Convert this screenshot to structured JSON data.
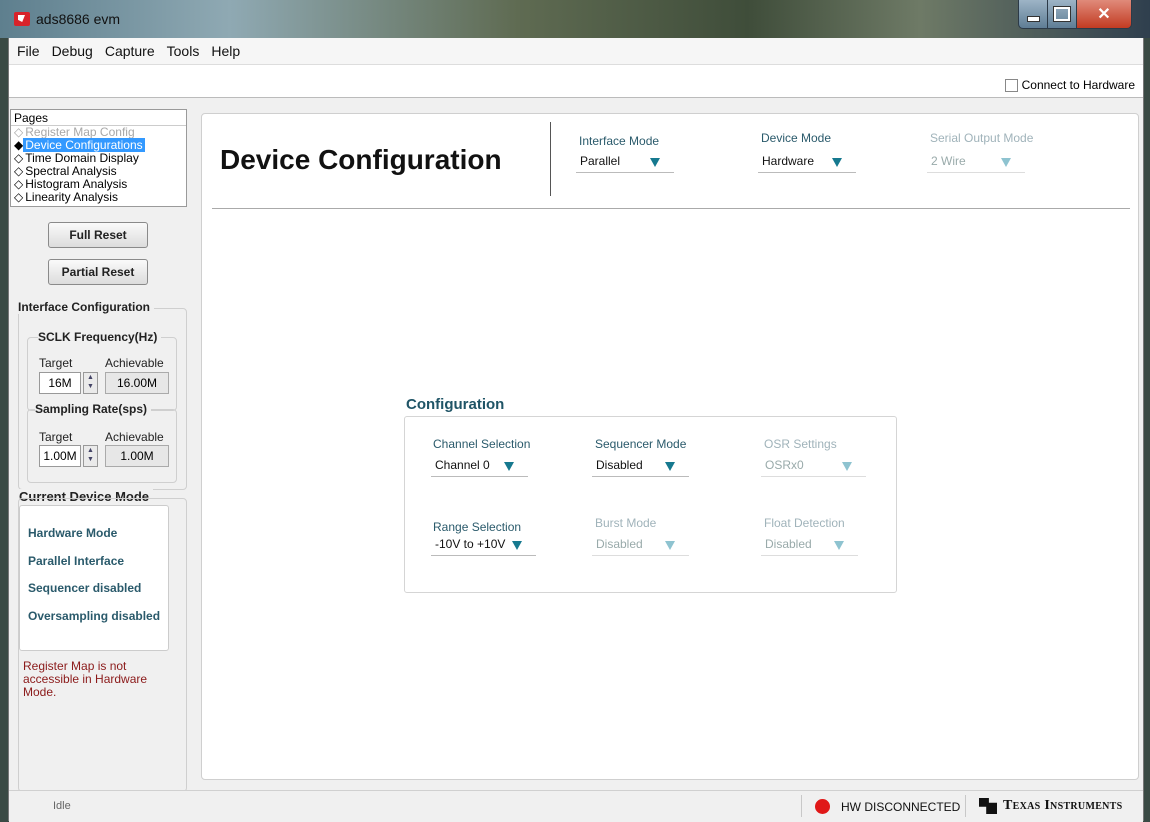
{
  "window": {
    "title": "ads8686 evm"
  },
  "menu": [
    "File",
    "Debug",
    "Capture",
    "Tools",
    "Help"
  ],
  "topbar": {
    "connect_label": "Connect to Hardware",
    "connect_checked": false
  },
  "pages": {
    "title": "Pages",
    "items": [
      {
        "label": "Register Map Config",
        "state": "disabled"
      },
      {
        "label": "Device Configurations",
        "state": "selected"
      },
      {
        "label": "Time Domain Display",
        "state": "normal"
      },
      {
        "label": "Spectral Analysis",
        "state": "normal"
      },
      {
        "label": "Histogram Analysis",
        "state": "normal"
      },
      {
        "label": "Linearity Analysis",
        "state": "normal"
      }
    ]
  },
  "buttons": {
    "full_reset": "Full Reset",
    "partial_reset": "Partial Reset"
  },
  "interface_config": {
    "title": "Interface Configuration",
    "sclk": {
      "title": "SCLK Frequency(Hz)",
      "target_label": "Target",
      "achievable_label": "Achievable",
      "target": "16M",
      "achievable": "16.00M"
    },
    "sampling": {
      "title": "Sampling Rate(sps)",
      "target_label": "Target",
      "achievable_label": "Achievable",
      "target": "1.00M",
      "achievable": "1.00M"
    }
  },
  "current_mode": {
    "title": "Current Device Mode",
    "lines": [
      "Hardware Mode",
      "Parallel Interface",
      "Sequencer disabled",
      "Oversampling disabled"
    ],
    "warning": "Register Map is  not accessible in Hardware Mode."
  },
  "main": {
    "title": "Device Configuration",
    "interface_mode": {
      "label": "Interface Mode",
      "value": "Parallel"
    },
    "device_mode": {
      "label": "Device Mode",
      "value": "Hardware"
    },
    "serial_output_mode": {
      "label": "Serial Output Mode",
      "value": "2 Wire"
    }
  },
  "configuration": {
    "title": "Configuration",
    "channel_selection": {
      "label": "Channel Selection",
      "value": "Channel 0"
    },
    "sequencer_mode": {
      "label": "Sequencer Mode",
      "value": "Disabled"
    },
    "osr_settings": {
      "label": "OSR Settings",
      "value": "OSRx0"
    },
    "range_selection": {
      "label": "Range Selection",
      "value": "-10V to +10V"
    },
    "burst_mode": {
      "label": "Burst Mode",
      "value": "Disabled"
    },
    "float_detection": {
      "label": "Float Detection",
      "value": "Disabled"
    }
  },
  "status": {
    "idle": "Idle",
    "hw": "HW DISCONNECTED",
    "brand": "Texas Instruments",
    "hw_color": "#e01818"
  }
}
